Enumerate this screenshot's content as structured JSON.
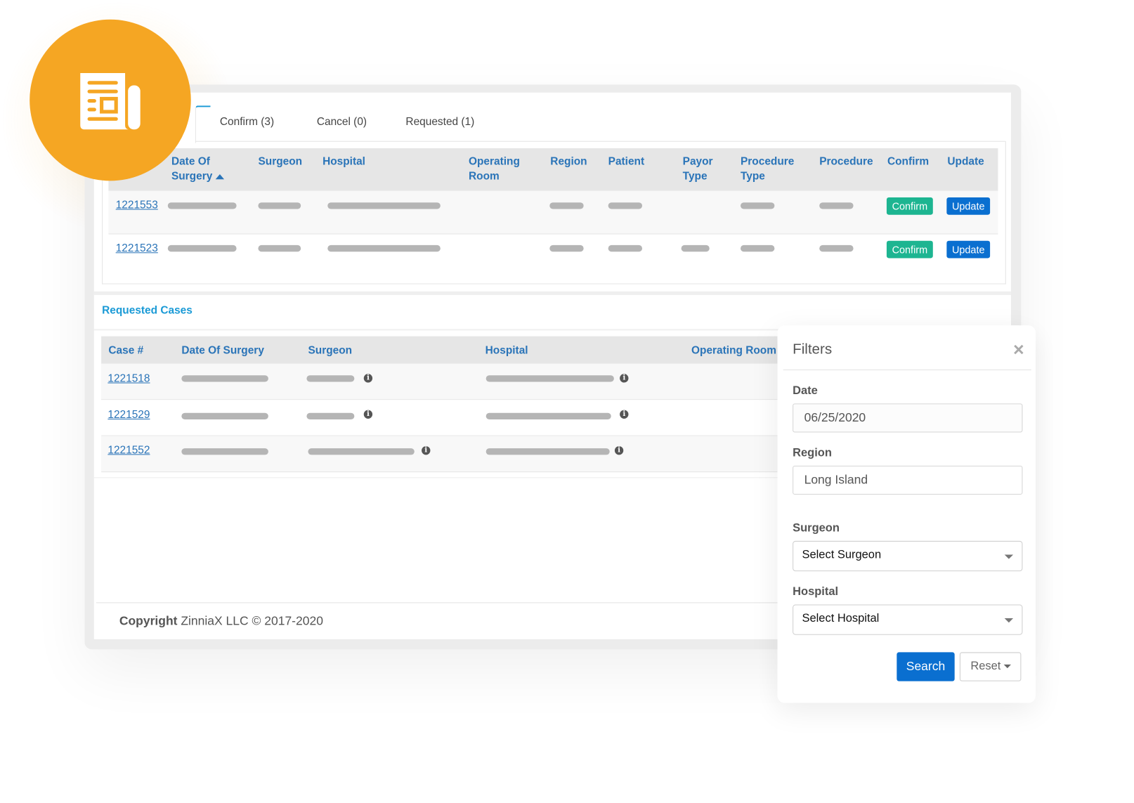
{
  "badge": {
    "icon": "newspaper-icon",
    "color": "#f5a623"
  },
  "tabs": [
    {
      "label": "Confirm (3)"
    },
    {
      "label": "Cancel (0)"
    },
    {
      "label": "Requested (1)"
    }
  ],
  "confirm_table": {
    "headers": [
      "Date Of Surgery",
      "Surgeon",
      "Hospital",
      "Operating Room",
      "Region",
      "Patient",
      "Payor Type",
      "Procedure Type",
      "Procedure",
      "Confirm",
      "Update"
    ],
    "rows": [
      {
        "case": "1221553",
        "confirm": "Confirm",
        "update": "Update"
      },
      {
        "case": "1221523",
        "confirm": "Confirm",
        "update": "Update"
      }
    ]
  },
  "requested": {
    "title": "Requested Cases",
    "headers": [
      "Case #",
      "Date Of Surgery",
      "Surgeon",
      "Hospital",
      "Operating Room"
    ],
    "rows": [
      {
        "case": "1221518"
      },
      {
        "case": "1221529"
      },
      {
        "case": "1221552"
      }
    ]
  },
  "footer": {
    "bold": "Copyright",
    "text": "ZinniaX LLC © 2017-2020"
  },
  "filters": {
    "title": "Filters",
    "date_label": "Date",
    "date_value": "06/25/2020",
    "region_label": "Region",
    "region_value": "Long Island",
    "surgeon_label": "Surgeon",
    "surgeon_value": "Select Surgeon",
    "hospital_label": "Hospital",
    "hospital_value": "Select Hospital",
    "search": "Search",
    "reset": "Reset"
  },
  "colors": {
    "accent": "#2a74b8",
    "confirm": "#1db591",
    "update": "#0a6fd0",
    "link": "#1a9ad6"
  }
}
